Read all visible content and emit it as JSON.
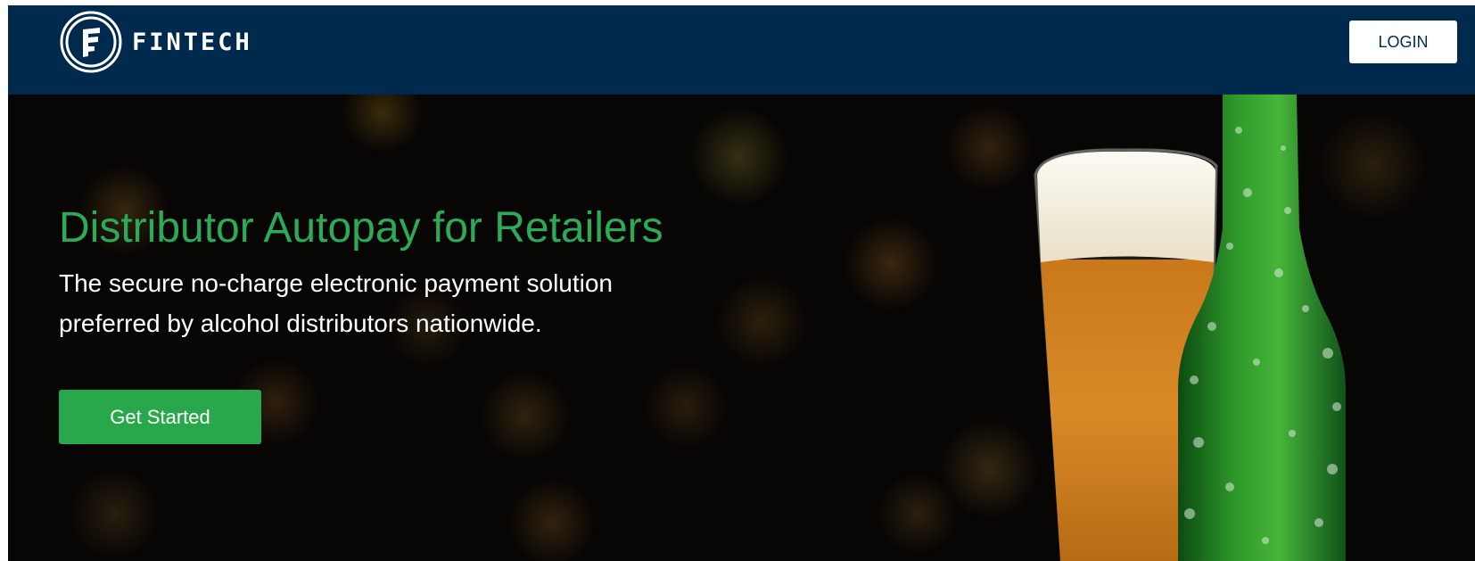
{
  "navbar": {
    "brand_name": "FINTECH",
    "logo_icon": "fintech-stacked-f-logo",
    "login_label": "LOGIN",
    "background_color": "#002a4d"
  },
  "hero": {
    "title": "Distributor Autopay for Retailers",
    "subtitle": "The secure no-charge electronic payment solution preferred by alcohol distributors nationwide.",
    "cta_label": "Get Started",
    "title_color": "#2daa58",
    "cta_color": "#28a84a",
    "image_subject": "beer-glass-and-bottle"
  }
}
